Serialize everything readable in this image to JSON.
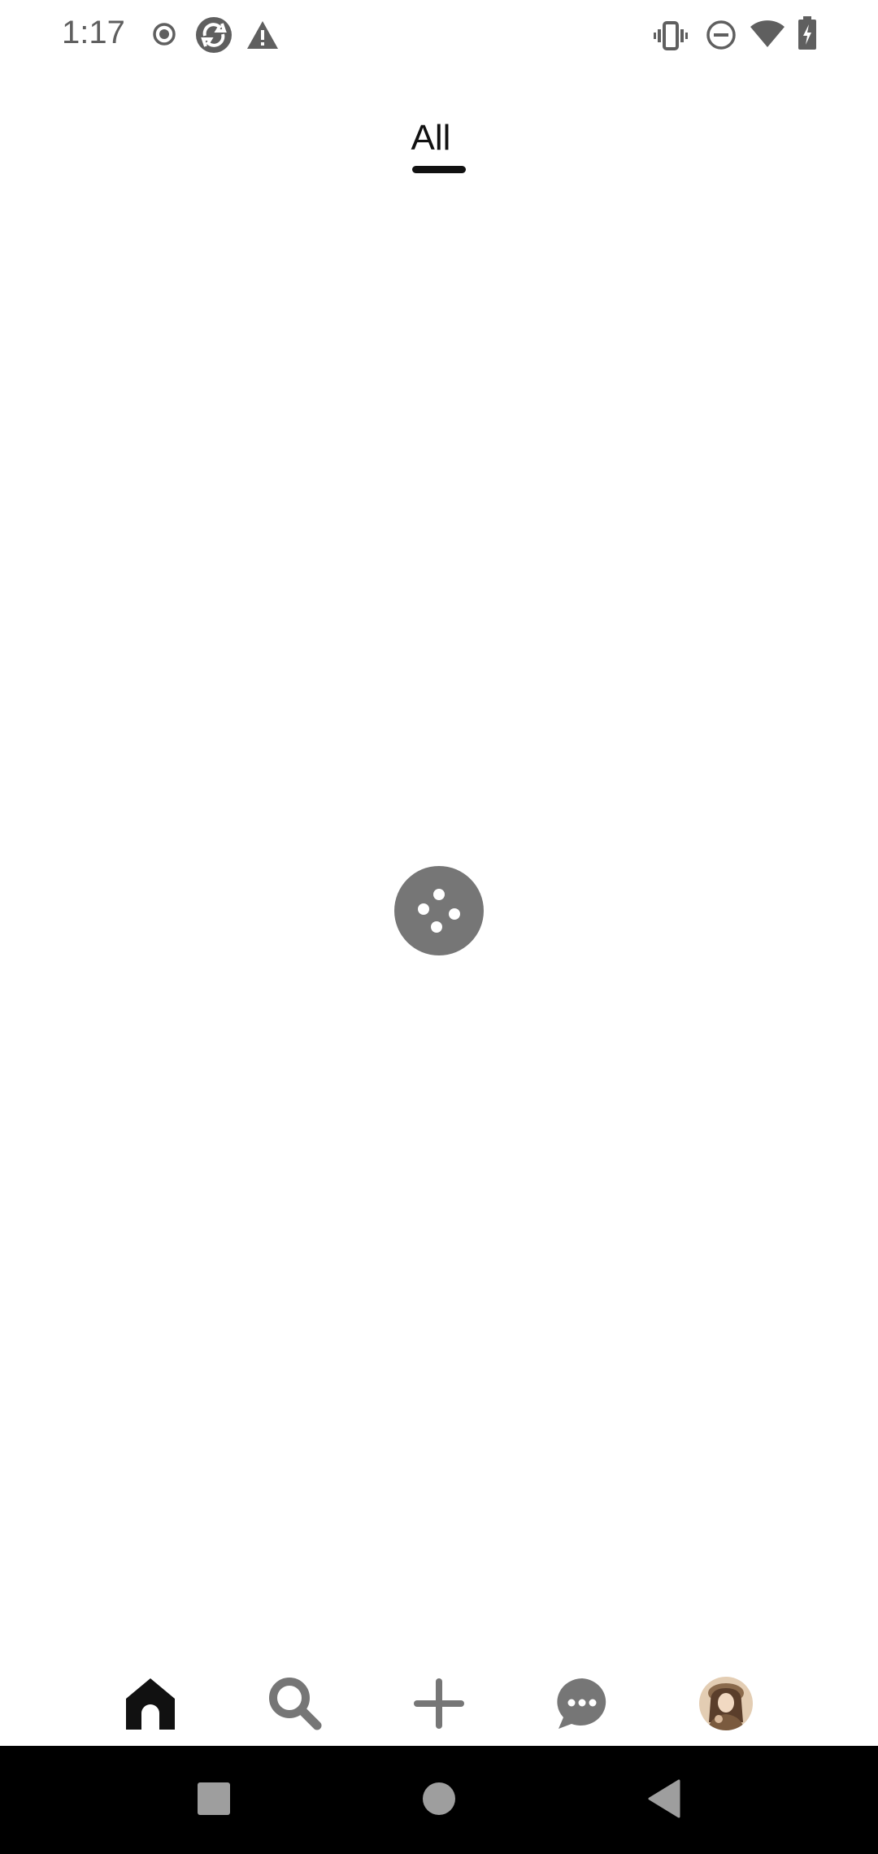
{
  "status_bar": {
    "time": "1:17",
    "left_icons": [
      "record-icon",
      "sync-app-icon",
      "warning-icon"
    ],
    "right_icons": [
      "vibrate-icon",
      "do-not-disturb-icon",
      "wifi-icon",
      "battery-charging-icon"
    ]
  },
  "tabs": [
    {
      "label": "All",
      "selected": true
    }
  ],
  "content": {
    "state": "loading",
    "loader_icon": "loading-dots-icon"
  },
  "bottom_nav": {
    "items": [
      {
        "name": "home",
        "icon": "home-icon",
        "active": true
      },
      {
        "name": "search",
        "icon": "search-icon",
        "active": false
      },
      {
        "name": "create",
        "icon": "plus-icon",
        "active": false
      },
      {
        "name": "messages",
        "icon": "chat-bubble-icon",
        "active": false
      },
      {
        "name": "profile",
        "icon": "avatar",
        "active": false
      }
    ]
  },
  "system_nav": {
    "buttons": [
      "recents-button",
      "home-button",
      "back-button"
    ]
  },
  "colors": {
    "active_icon": "#111111",
    "inactive_icon": "#767676",
    "status_text": "#5f5f5f",
    "background": "#ffffff",
    "system_bar": "#000000"
  }
}
